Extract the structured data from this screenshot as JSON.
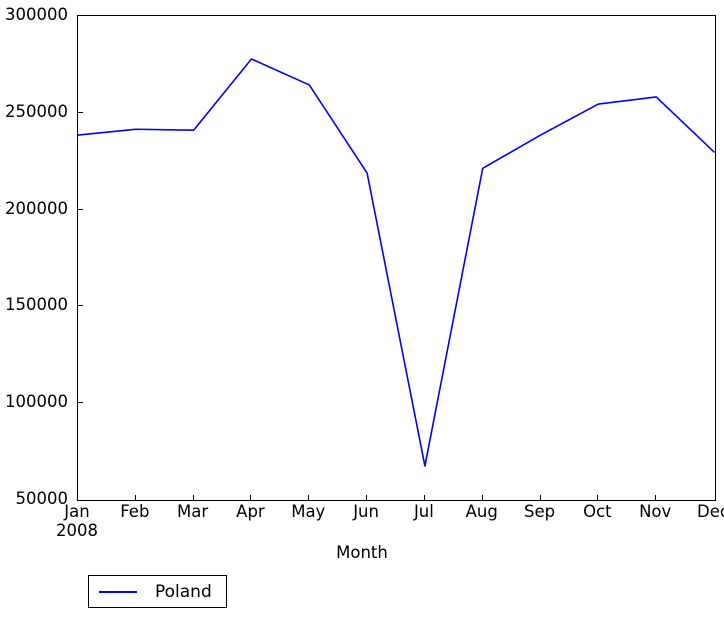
{
  "chart_data": {
    "type": "line",
    "title": "",
    "subtitle": "",
    "xlabel": "Month",
    "ylabel": "",
    "categories": [
      "Jan",
      "Feb",
      "Mar",
      "Apr",
      "May",
      "Jun",
      "Jul",
      "Aug",
      "Sep",
      "Oct",
      "Nov",
      "Dec"
    ],
    "x_axis_year": "2008",
    "series": [
      {
        "name": "Poland",
        "color": "#0000ff",
        "values": [
          238500,
          241500,
          241000,
          277800,
          264400,
          218900,
          67600,
          221300,
          238500,
          254500,
          258200,
          229800
        ]
      }
    ],
    "xlim": [
      "Jan",
      "Dec"
    ],
    "ylim": [
      50000,
      300000
    ],
    "ytick_labels": [
      "50000",
      "100000",
      "150000",
      "200000",
      "250000",
      "300000"
    ],
    "ytick_values": [
      50000,
      100000,
      150000,
      200000,
      250000,
      300000
    ],
    "grid": false,
    "legend": {
      "position": "below-left",
      "entries": [
        "Poland"
      ]
    }
  }
}
